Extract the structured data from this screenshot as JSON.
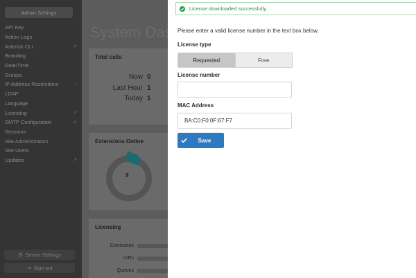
{
  "sidebar": {
    "header": "Admin Settings",
    "items": [
      {
        "label": "API Key",
        "ext": false
      },
      {
        "label": "Action Logs",
        "ext": false
      },
      {
        "label": "Asterisk CLI",
        "ext": true
      },
      {
        "label": "Branding",
        "ext": false
      },
      {
        "label": "Date/Time",
        "ext": false
      },
      {
        "label": "Groups",
        "ext": false
      },
      {
        "label": "IP Address Restrictions",
        "chevron": true
      },
      {
        "label": "LDAP",
        "ext": false
      },
      {
        "label": "Language",
        "ext": false
      },
      {
        "label": "Licensing",
        "ext": true
      },
      {
        "label": "SMTP Configuration",
        "ext": true
      },
      {
        "label": "Sessions",
        "ext": false
      },
      {
        "label": "Site Administrators",
        "ext": false
      },
      {
        "label": "Site Users",
        "ext": false
      },
      {
        "label": "Updates",
        "ext": true
      }
    ],
    "server_settings": "Server Settings",
    "sign_out": "Sign out"
  },
  "dashboard": {
    "title": "System Das",
    "total_calls": {
      "title": "Total calls",
      "rows": [
        {
          "label": "Now",
          "value": "0"
        },
        {
          "label": "Last Hour",
          "value": "1"
        },
        {
          "label": "Today",
          "value": "1"
        }
      ]
    },
    "extensions_online": {
      "title": "Extensions Online",
      "value": "9"
    },
    "licensing": {
      "title": "Licensing",
      "rows": [
        "Extensions",
        "IVRs",
        "Queues"
      ]
    }
  },
  "modal": {
    "alert": "License downloaded successfully.",
    "instructions": "Please enter a valid license number in the text box below.",
    "license_type_label": "License type",
    "license_type_options": [
      "Requested",
      "Free"
    ],
    "license_type_selected": "Requested",
    "license_number_label": "License number",
    "license_number_value": "",
    "mac_label": "MAC Address",
    "mac_value": "BA:C0:F0:0F:67:F7",
    "save_label": "Save"
  },
  "colors": {
    "success": "#2f9a47",
    "primary": "#2d7ac0",
    "teal_accent": "#1d6a6e"
  }
}
